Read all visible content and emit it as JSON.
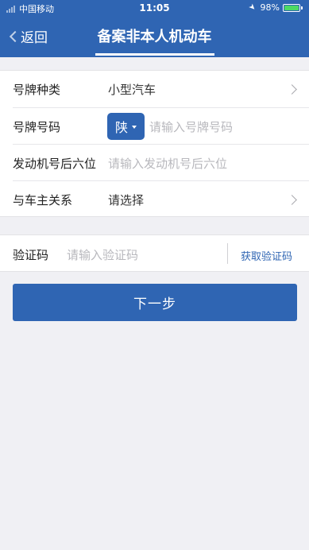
{
  "status_bar": {
    "carrier": "中国移动",
    "time": "11:05",
    "battery_percent": "98%",
    "battery_level": 0.98,
    "icons": [
      "signal-icon",
      "location-icon",
      "battery-icon"
    ]
  },
  "nav": {
    "back_label": "返回",
    "title": "备案非本人机动车"
  },
  "form": {
    "plate_type": {
      "label": "号牌种类",
      "value": "小型汽车"
    },
    "plate_number": {
      "label": "号牌号码",
      "province": "陕",
      "placeholder": "请输入号牌号码"
    },
    "engine_no": {
      "label": "发动机号后六位",
      "placeholder": "请输入发动机号后六位"
    },
    "relation": {
      "label": "与车主关系",
      "value": "请选择"
    }
  },
  "verify": {
    "label": "验证码",
    "placeholder": "请输入验证码",
    "get_code_label": "获取验证码"
  },
  "next_button_label": "下一步",
  "colors": {
    "primary": "#2f65b3",
    "background": "#f0f0f4",
    "placeholder": "#b8b8bd",
    "battery": "#4cd964"
  }
}
